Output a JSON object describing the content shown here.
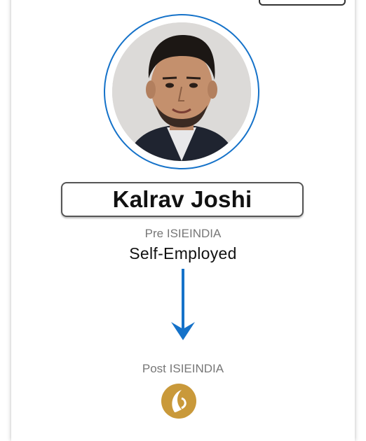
{
  "profile": {
    "name": "Kalrav Joshi",
    "avatar_icon": "profile-photo"
  },
  "pre": {
    "label": "Pre ISIEINDIA",
    "value": "Self-Employed"
  },
  "post": {
    "label": "Post ISIEINDIA",
    "company_logo_icon": "reliance-logo"
  },
  "colors": {
    "accent": "#1572c9",
    "logo": "#c9993a",
    "muted_text": "#777777"
  }
}
